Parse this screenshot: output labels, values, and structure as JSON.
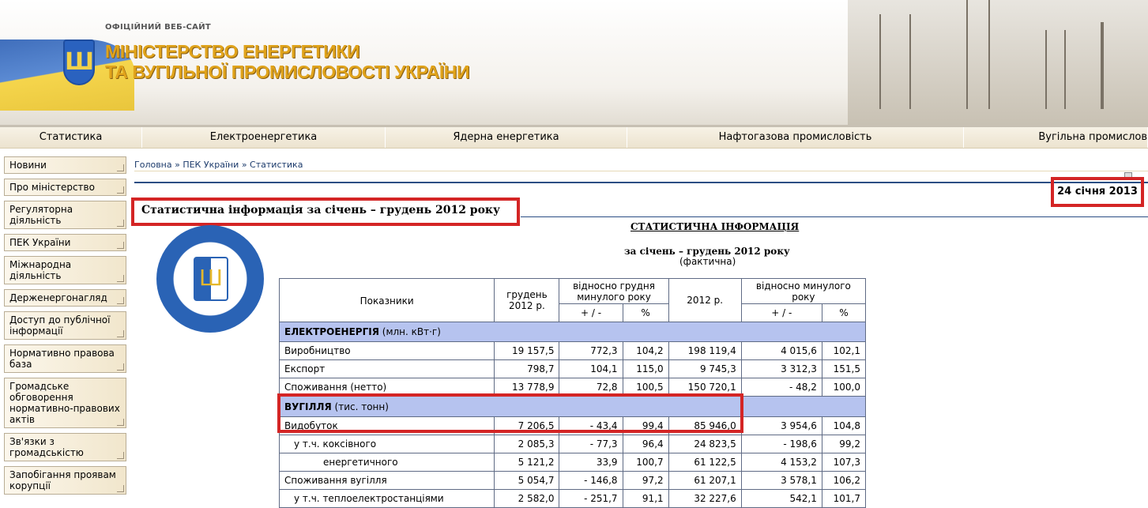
{
  "header": {
    "official": "ОФІЦІЙНИЙ ВЕБ-САЙТ",
    "ministry_line1": "МІНІСТЕРСТВО ЕНЕРГЕТИКИ",
    "ministry_line2": "ТА ВУГІЛЬНОЇ ПРОМИСЛОВОСТІ УКРАЇНИ"
  },
  "nav": [
    "Статистика",
    "Електроенергетика",
    "Ядерна енергетика",
    "Нафтогазова промисловість",
    "Вугільна промислов"
  ],
  "sidebar": [
    "Новини",
    "Про міністерство",
    "Регуляторна діяльність",
    "ПЕК України",
    "Міжнародна діяльність",
    "Держенергонагляд",
    "Доступ до публічної інформації",
    "Нормативно правова база",
    "Громадське обговорення нормативно-правових актів",
    "Зв'язки з громадськістю",
    "Запобігання проявам корупції"
  ],
  "breadcrumbs": "Головна » ПЕК України » Статистика",
  "date": "24 січня 2013",
  "title": "Статистична інформація за січень – грудень 2012 року",
  "seal_text": "МІНІСТЕРСТВО ЕНЕРГЕТИКИ ТА ВУГІЛЬНОЇ ПРОМИСЛОВОСТІ",
  "doc": {
    "heading": "СТАТИСТИЧНА ІНФОРМАЦІЯ",
    "period": "за січень – грудень 2012 року",
    "fact": "(фактична)"
  },
  "table": {
    "h_indicators": "Показники",
    "h_dec": "грудень 2012 р.",
    "h_rel_dec": "відносно грудня минулого року",
    "h_2012": "2012 р.",
    "h_rel_year": "відносно минулого року",
    "h_pm": "+ / -",
    "h_pct": "%",
    "sec1": "ЕЛЕКТРОЕНЕРГІЯ",
    "sec1_unit": "(млн. кВт·г)",
    "sec2": "ВУГІЛЛЯ",
    "sec2_unit": "(тис. тонн)",
    "rows": [
      [
        "Виробництво",
        "19 157,5",
        "772,3",
        "104,2",
        "198 119,4",
        "4 015,6",
        "102,1"
      ],
      [
        "Експорт",
        "798,7",
        "104,1",
        "115,0",
        "9 745,3",
        "3 312,3",
        "151,5"
      ],
      [
        "Споживання (нетто)",
        "13 778,9",
        "72,8",
        "100,5",
        "150 720,1",
        "- 48,2",
        "100,0"
      ],
      [
        "Видобуток",
        "7 206,5",
        "- 43,4",
        "99,4",
        "85 946,0",
        "3 954,6",
        "104,8"
      ],
      [
        "у т.ч. коксівного",
        "2 085,3",
        "- 77,3",
        "96,4",
        "24 823,5",
        "- 198,6",
        "99,2"
      ],
      [
        "енергетичного",
        "5 121,2",
        "33,9",
        "100,7",
        "61 122,5",
        "4 153,2",
        "107,3"
      ],
      [
        "Споживання вугілля",
        "5 054,7",
        "- 146,8",
        "97,2",
        "61 207,1",
        "3 578,1",
        "106,2"
      ],
      [
        "у т.ч. теплоелектростанціями",
        "2 582,0",
        "- 251,7",
        "91,1",
        "32 227,6",
        "542,1",
        "101,7"
      ]
    ]
  }
}
